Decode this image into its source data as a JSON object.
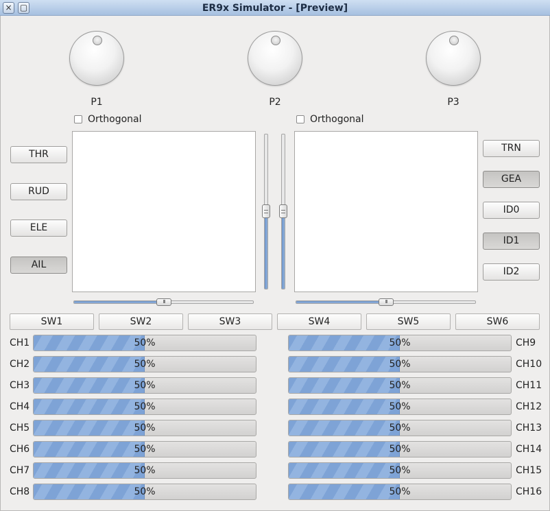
{
  "window": {
    "title": "ER9x Simulator - [Preview]",
    "close_glyph": "×",
    "restore_glyph": "▢"
  },
  "knobs": [
    {
      "label": "P1"
    },
    {
      "label": "P2"
    },
    {
      "label": "P3"
    }
  ],
  "left_stick": {
    "orthogonal_label": "Orthogonal",
    "orthogonal_checked": false,
    "hslider_value": 50,
    "vslider_value": 50
  },
  "right_stick": {
    "orthogonal_label": "Orthogonal",
    "orthogonal_checked": false,
    "hslider_value": 50,
    "vslider_value": 50
  },
  "handle_grip": "III",
  "left_buttons": [
    {
      "label": "THR",
      "pressed": false
    },
    {
      "label": "RUD",
      "pressed": false
    },
    {
      "label": "ELE",
      "pressed": false
    },
    {
      "label": "AIL",
      "pressed": true
    }
  ],
  "right_buttons": [
    {
      "label": "TRN",
      "pressed": false
    },
    {
      "label": "GEA",
      "pressed": true
    },
    {
      "label": "ID0",
      "pressed": false
    },
    {
      "label": "ID1",
      "pressed": true
    },
    {
      "label": "ID2",
      "pressed": false
    }
  ],
  "switches": [
    "SW1",
    "SW2",
    "SW3",
    "SW4",
    "SW5",
    "SW6"
  ],
  "channels_left": [
    {
      "label": "CH1",
      "value": 50,
      "text": "50%"
    },
    {
      "label": "CH2",
      "value": 50,
      "text": "50%"
    },
    {
      "label": "CH3",
      "value": 50,
      "text": "50%"
    },
    {
      "label": "CH4",
      "value": 50,
      "text": "50%"
    },
    {
      "label": "CH5",
      "value": 50,
      "text": "50%"
    },
    {
      "label": "CH6",
      "value": 50,
      "text": "50%"
    },
    {
      "label": "CH7",
      "value": 50,
      "text": "50%"
    },
    {
      "label": "CH8",
      "value": 50,
      "text": "50%"
    }
  ],
  "channels_right": [
    {
      "label": "CH9",
      "value": 50,
      "text": "50%"
    },
    {
      "label": "CH10",
      "value": 50,
      "text": "50%"
    },
    {
      "label": "CH11",
      "value": 50,
      "text": "50%"
    },
    {
      "label": "CH12",
      "value": 50,
      "text": "50%"
    },
    {
      "label": "CH13",
      "value": 50,
      "text": "50%"
    },
    {
      "label": "CH14",
      "value": 50,
      "text": "50%"
    },
    {
      "label": "CH15",
      "value": 50,
      "text": "50%"
    },
    {
      "label": "CH16",
      "value": 50,
      "text": "50%"
    }
  ]
}
